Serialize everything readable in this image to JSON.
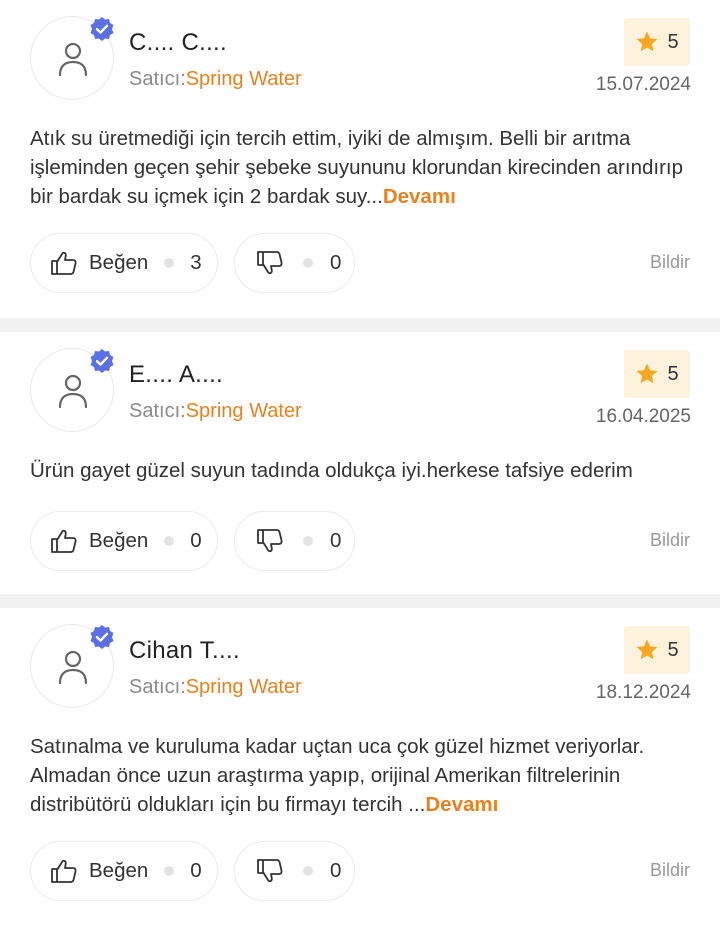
{
  "reviews": [
    {
      "author": "C.... C....",
      "seller_label": "Satıcı:",
      "seller_name": "Spring Water",
      "rating": "5",
      "date": "15.07.2024",
      "text": "Atık su üretmediği için tercih ettim, iyiki de almışım. Belli bir arıtma işleminden geçen şehir şebeke suyununu klorundan kirecinden arındırıp bir bardak su içmek için 2 bardak suy...",
      "more": "Devamı",
      "like_label": "Beğen",
      "likes": "3",
      "dislikes": "0",
      "report": "Bildir"
    },
    {
      "author": "E.... A....",
      "seller_label": "Satıcı:",
      "seller_name": "Spring Water",
      "rating": "5",
      "date": "16.04.2025",
      "text": "Ürün gayet güzel suyun tadında oldukça iyi.herkese tafsiye ederim",
      "more": "",
      "like_label": "Beğen",
      "likes": "0",
      "dislikes": "0",
      "report": "Bildir"
    },
    {
      "author": "Cihan T....",
      "seller_label": "Satıcı:",
      "seller_name": "Spring Water",
      "rating": "5",
      "date": "18.12.2024",
      "text": "Satınalma ve kuruluma kadar uçtan uca çok güzel hizmet veriyorlar. Almadan önce uzun araştırma yapıp, orijinal Amerikan filtrelerinin distribütörü oldukları için bu firmayı tercih ...",
      "more": "Devamı",
      "like_label": "Beğen",
      "likes": "0",
      "dislikes": "0",
      "report": "Bildir"
    }
  ],
  "icons": {
    "avatar": "user-icon",
    "verified": "verified-badge-icon",
    "rating": "star-icon",
    "like": "thumbs-up-icon",
    "dislike": "thumbs-down-icon"
  },
  "colors": {
    "accent": "#e8821e",
    "verified": "#5b6fe6",
    "star": "#f5a623",
    "rating_bg": "#fdf3dc",
    "divider": "#f1f1f1"
  }
}
